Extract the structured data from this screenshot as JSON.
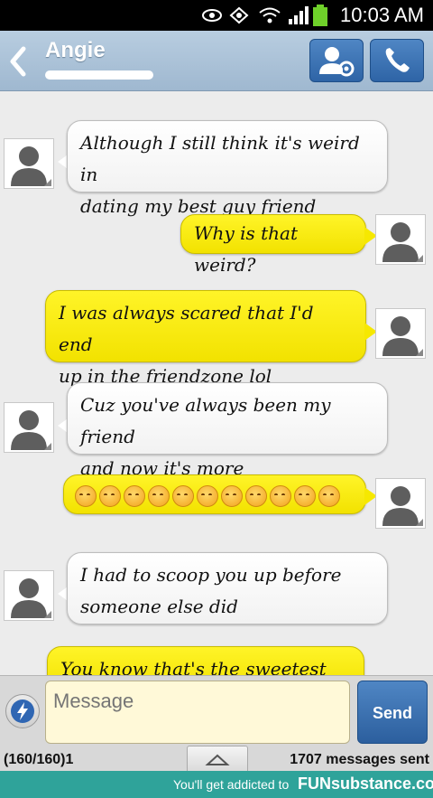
{
  "status_bar": {
    "time": "10:03 AM",
    "icons": [
      "eye-icon",
      "sync-icon",
      "wifi-icon",
      "signal-icon",
      "battery-icon"
    ]
  },
  "header": {
    "contact_name": "Angie",
    "contact_settings_icon": "contact-settings-icon",
    "call_icon": "phone-icon"
  },
  "messages": [
    {
      "direction": "incoming",
      "text_lines": [
        "Although I still think it's weird in",
        "dating my best guy friend"
      ]
    },
    {
      "direction": "outgoing",
      "text_lines": [
        "Why is that weird?"
      ]
    },
    {
      "direction": "outgoing",
      "text_lines": [
        "I was always scared that I'd end",
        "up in the friendzone lol"
      ]
    },
    {
      "direction": "incoming",
      "text_lines": [
        "Cuz you've always been my friend",
        "and now it's more"
      ]
    },
    {
      "direction": "outgoing",
      "emoji_count": 11,
      "emoji": "blushing-smiley-emoji"
    },
    {
      "direction": "incoming",
      "text_lines": [
        "I had to scoop you up before",
        "someone else did"
      ]
    },
    {
      "direction": "outgoing",
      "text_lines": [
        "You know that's the sweetest thing"
      ]
    }
  ],
  "composer": {
    "placeholder": "Message",
    "send_label": "Send",
    "char_counter": "(160/160)1",
    "messages_sent": "1707 messages sent"
  },
  "footer": {
    "tagline": "You'll get addicted to",
    "brand": "FUNsubstance.com"
  },
  "colors": {
    "incoming_bubble": "#ffffff",
    "outgoing_bubble": "#fff200",
    "header": "#a9c0d6",
    "button_blue": "#3a70b4",
    "footer": "#2fa39a"
  }
}
